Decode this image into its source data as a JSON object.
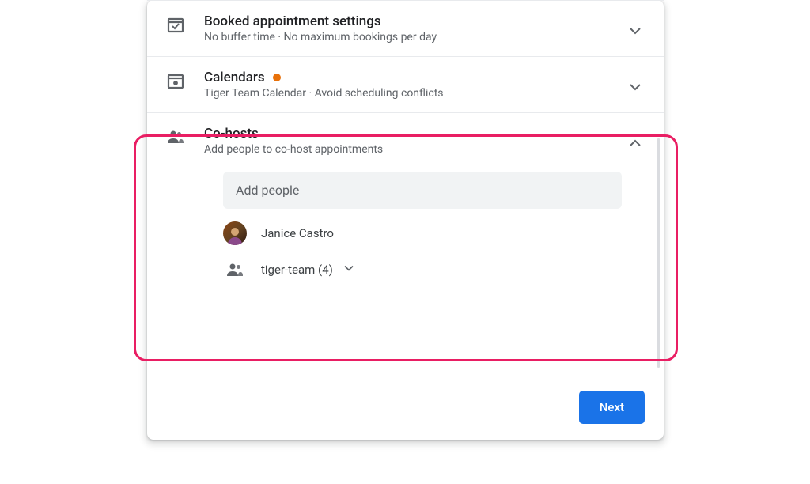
{
  "sections": {
    "booked": {
      "title": "Booked appointment settings",
      "subtitle": "No buffer time · No maximum bookings per day"
    },
    "calendars": {
      "title": "Calendars",
      "subtitle": "Tiger Team Calendar · Avoid scheduling conflicts",
      "has_indicator": true
    },
    "cohosts": {
      "title": "Co-hosts",
      "subtitle": "Add people to co-host appointments",
      "add_placeholder": "Add people",
      "people": [
        {
          "name": "Janice Castro",
          "type": "person"
        },
        {
          "name": "tiger-team (4)",
          "type": "group"
        }
      ]
    }
  },
  "footer": {
    "next_label": "Next"
  }
}
